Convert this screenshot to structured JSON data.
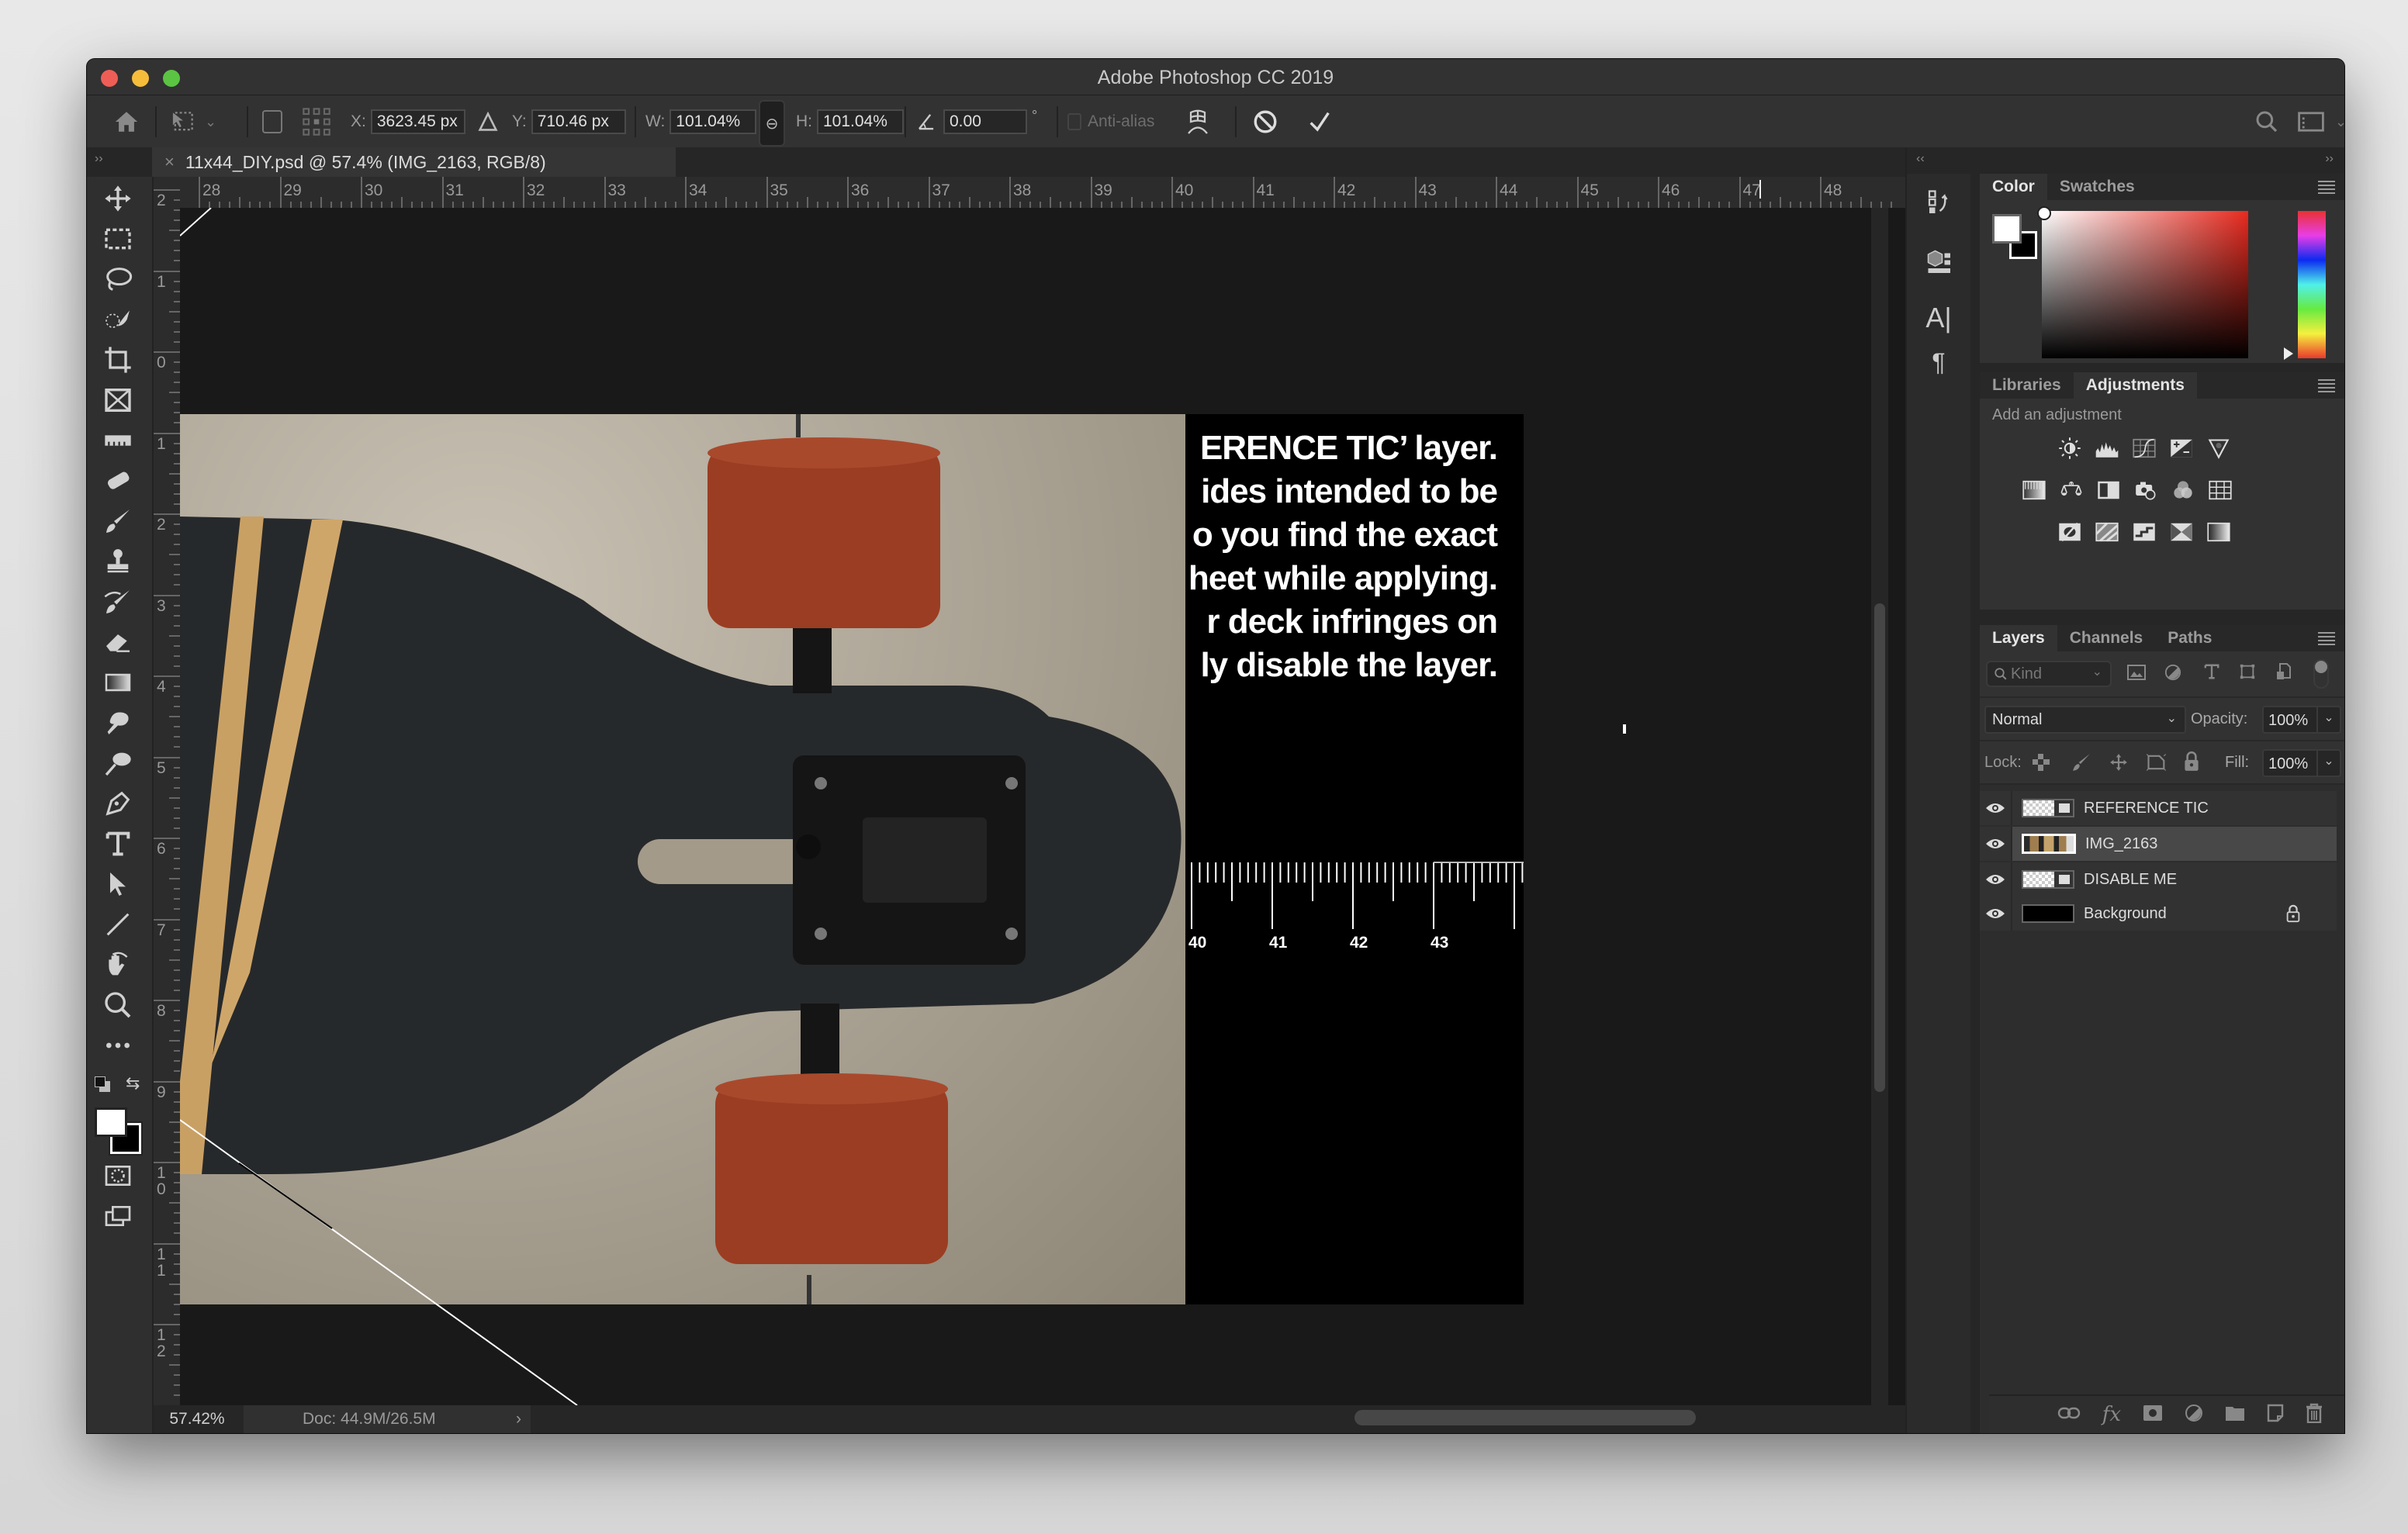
{
  "window": {
    "title": "Adobe Photoshop CC 2019"
  },
  "options_bar": {
    "x_label": "X:",
    "x_value": "3623.45 px",
    "y_label": "Y:",
    "y_value": "710.46 px",
    "w_label": "W:",
    "w_value": "101.04%",
    "h_label": "H:",
    "h_value": "101.04%",
    "angle_value": "0.00",
    "degree_symbol": "°",
    "antialias_label": "Anti-alias",
    "antialias_checked": false
  },
  "document_tab": {
    "close": "×",
    "title": "11x44_DIY.psd @ 57.4% (IMG_2163, RGB/8)"
  },
  "collapse": {
    "left": "››",
    "right": "››",
    "panels_left": "‹‹"
  },
  "horizontal_ruler": [
    "28",
    "29",
    "30",
    "31",
    "32",
    "33",
    "34",
    "35",
    "36",
    "37",
    "38",
    "39",
    "40",
    "41",
    "42",
    "43",
    "44",
    "45",
    "46",
    "47",
    "48"
  ],
  "vertical_ruler": [
    "2",
    "1",
    "0",
    "1",
    "2",
    "3",
    "4",
    "5",
    "6",
    "7",
    "8",
    "9",
    "10",
    "11",
    "12"
  ],
  "canvas": {
    "overlay_text": [
      "ERENCE TIC’ layer.",
      "ides intended to be",
      "o you find the exact",
      "heet while applying.",
      "r deck infringes on",
      "ly disable the layer."
    ],
    "scale_labels": [
      "40",
      "41",
      "42",
      "43"
    ]
  },
  "status_bar": {
    "zoom": "57.42%",
    "doc_info": "Doc: 44.9M/26.5M",
    "arrow": "›"
  },
  "color_panel": {
    "tabs": [
      "Color",
      "Swatches"
    ],
    "active_tab": "Color",
    "foreground": "#ffffff",
    "background": "#000000",
    "hue": "#ff0000"
  },
  "adjustments_panel": {
    "tabs": [
      "Libraries",
      "Adjustments"
    ],
    "active_tab": "Adjustments",
    "prompt": "Add an adjustment"
  },
  "layers_panel": {
    "tabs": [
      "Layers",
      "Channels",
      "Paths"
    ],
    "active_tab": "Layers",
    "filter_placeholder": "Kind",
    "blend_mode": "Normal",
    "opacity_label": "Opacity:",
    "opacity_value": "100%",
    "lock_label": "Lock:",
    "fill_label": "Fill:",
    "fill_value": "100%",
    "layers": [
      {
        "name": "REFERENCE TIC",
        "visible": true,
        "selected": false,
        "locked": false
      },
      {
        "name": "IMG_2163",
        "visible": true,
        "selected": true,
        "locked": false
      },
      {
        "name": "DISABLE ME",
        "visible": true,
        "selected": false,
        "locked": false
      },
      {
        "name": "Background",
        "visible": true,
        "selected": false,
        "locked": true
      }
    ]
  }
}
